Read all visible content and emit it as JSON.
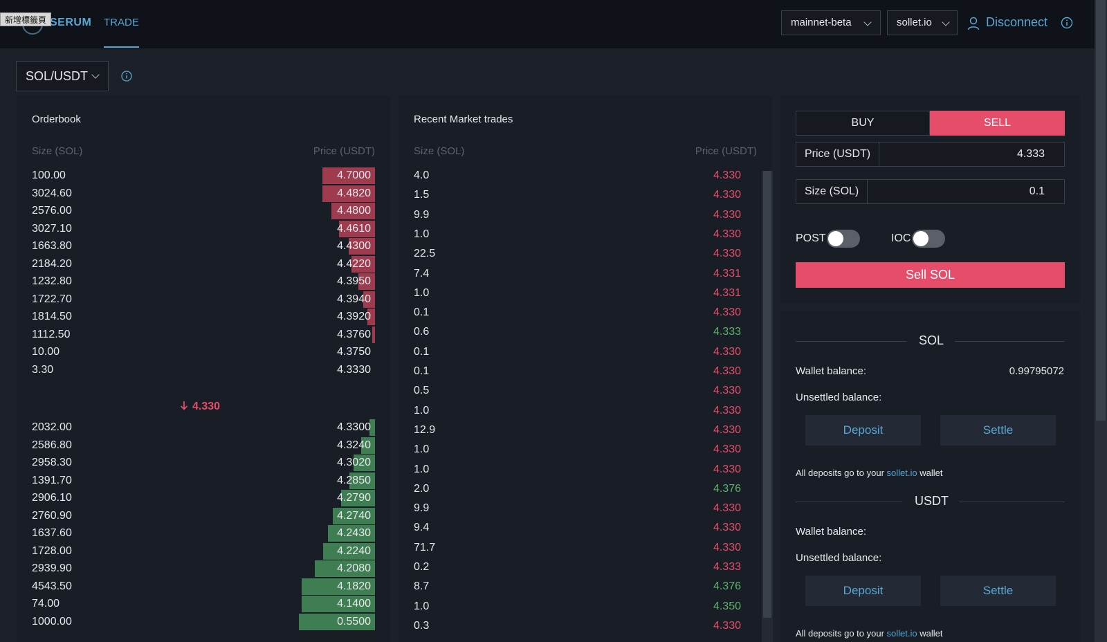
{
  "tab_tooltip": "新增標籤頁",
  "header": {
    "logo_text": "SERUM",
    "nav_trade": "TRADE",
    "network": "mainnet-beta",
    "wallet_provider": "sollet.io",
    "disconnect": "Disconnect"
  },
  "market": {
    "pair": "SOL/USDT"
  },
  "orderbook": {
    "title": "Orderbook",
    "size_header": "Size (SOL)",
    "price_header": "Price (USDT)",
    "asks": [
      {
        "size": "100.00",
        "price": "4.7000",
        "depth": 0.54
      },
      {
        "size": "3024.60",
        "price": "4.4820",
        "depth": 0.54
      },
      {
        "size": "2576.00",
        "price": "4.4800",
        "depth": 0.45
      },
      {
        "size": "3027.10",
        "price": "4.4610",
        "depth": 0.37
      },
      {
        "size": "1663.80",
        "price": "4.4300",
        "depth": 0.27
      },
      {
        "size": "2184.20",
        "price": "4.4220",
        "depth": 0.24
      },
      {
        "size": "1232.80",
        "price": "4.3950",
        "depth": 0.17
      },
      {
        "size": "1722.70",
        "price": "4.3940",
        "depth": 0.12
      },
      {
        "size": "1814.50",
        "price": "4.3920",
        "depth": 0.08
      },
      {
        "size": "1112.50",
        "price": "4.3760",
        "depth": 0.03
      },
      {
        "size": "10.00",
        "price": "4.3750",
        "depth": 0.0
      },
      {
        "size": "3.30",
        "price": "4.3330",
        "depth": 0.0
      }
    ],
    "last_price": "4.330",
    "bids": [
      {
        "size": "2032.00",
        "price": "4.3300",
        "depth": 0.06
      },
      {
        "size": "2586.80",
        "price": "4.3240",
        "depth": 0.14
      },
      {
        "size": "2958.30",
        "price": "4.3020",
        "depth": 0.22
      },
      {
        "size": "1391.70",
        "price": "4.2850",
        "depth": 0.26
      },
      {
        "size": "2906.10",
        "price": "4.2790",
        "depth": 0.35
      },
      {
        "size": "2760.90",
        "price": "4.2740",
        "depth": 0.43
      },
      {
        "size": "1637.60",
        "price": "4.2430",
        "depth": 0.48
      },
      {
        "size": "1728.00",
        "price": "4.2240",
        "depth": 0.53
      },
      {
        "size": "2939.90",
        "price": "4.2080",
        "depth": 0.62
      },
      {
        "size": "4543.50",
        "price": "4.1820",
        "depth": 0.75
      },
      {
        "size": "74.00",
        "price": "4.1400",
        "depth": 0.75
      },
      {
        "size": "1000.00",
        "price": "0.5500",
        "depth": 0.78
      }
    ]
  },
  "trades": {
    "title": "Recent Market trades",
    "size_header": "Size (SOL)",
    "price_header": "Price (USDT)",
    "rows": [
      {
        "size": "4.0",
        "price": "4.330",
        "side": "sell"
      },
      {
        "size": "1.5",
        "price": "4.330",
        "side": "sell"
      },
      {
        "size": "9.9",
        "price": "4.330",
        "side": "sell"
      },
      {
        "size": "1.0",
        "price": "4.330",
        "side": "sell"
      },
      {
        "size": "22.5",
        "price": "4.330",
        "side": "sell"
      },
      {
        "size": "7.4",
        "price": "4.331",
        "side": "sell"
      },
      {
        "size": "1.0",
        "price": "4.331",
        "side": "sell"
      },
      {
        "size": "0.1",
        "price": "4.330",
        "side": "sell"
      },
      {
        "size": "0.6",
        "price": "4.333",
        "side": "buy"
      },
      {
        "size": "0.1",
        "price": "4.330",
        "side": "sell"
      },
      {
        "size": "0.1",
        "price": "4.330",
        "side": "sell"
      },
      {
        "size": "0.5",
        "price": "4.330",
        "side": "sell"
      },
      {
        "size": "1.0",
        "price": "4.330",
        "side": "sell"
      },
      {
        "size": "12.9",
        "price": "4.330",
        "side": "sell"
      },
      {
        "size": "1.0",
        "price": "4.330",
        "side": "sell"
      },
      {
        "size": "1.0",
        "price": "4.330",
        "side": "sell"
      },
      {
        "size": "2.0",
        "price": "4.376",
        "side": "buy"
      },
      {
        "size": "9.9",
        "price": "4.330",
        "side": "sell"
      },
      {
        "size": "9.4",
        "price": "4.330",
        "side": "sell"
      },
      {
        "size": "71.7",
        "price": "4.330",
        "side": "sell"
      },
      {
        "size": "0.2",
        "price": "4.333",
        "side": "sell"
      },
      {
        "size": "8.7",
        "price": "4.376",
        "side": "buy"
      },
      {
        "size": "1.0",
        "price": "4.350",
        "side": "buy"
      },
      {
        "size": "0.3",
        "price": "4.330",
        "side": "sell"
      }
    ]
  },
  "trade_form": {
    "buy_label": "BUY",
    "sell_label": "SELL",
    "price_label": "Price (USDT)",
    "price_value": "4.333",
    "size_label": "Size (SOL)",
    "size_value": "0.1",
    "post_label": "POST",
    "ioc_label": "IOC",
    "submit_label": "Sell SOL"
  },
  "balances": {
    "sol": {
      "title": "SOL",
      "wallet_label": "Wallet balance:",
      "wallet_value": "0.99795072",
      "unsettled_label": "Unsettled balance:",
      "deposit_label": "Deposit",
      "settle_label": "Settle",
      "note_prefix": "All deposits go to your ",
      "note_link": "sollet.io",
      "note_suffix": " wallet"
    },
    "usdt": {
      "title": "USDT",
      "wallet_label": "Wallet balance:",
      "unsettled_label": "Unsettled balance:",
      "deposit_label": "Deposit",
      "settle_label": "Settle",
      "note_prefix": "All deposits go to your ",
      "note_link": "sollet.io",
      "note_suffix": " wallet"
    }
  },
  "colors": {
    "ask_bar": "#9e3b4f",
    "bid_bar": "#3f7d52",
    "sell_text": "#e54d6b",
    "buy_text": "#5cb36a",
    "accent": "#59a7d4",
    "sell_button": "#e54d6b"
  }
}
